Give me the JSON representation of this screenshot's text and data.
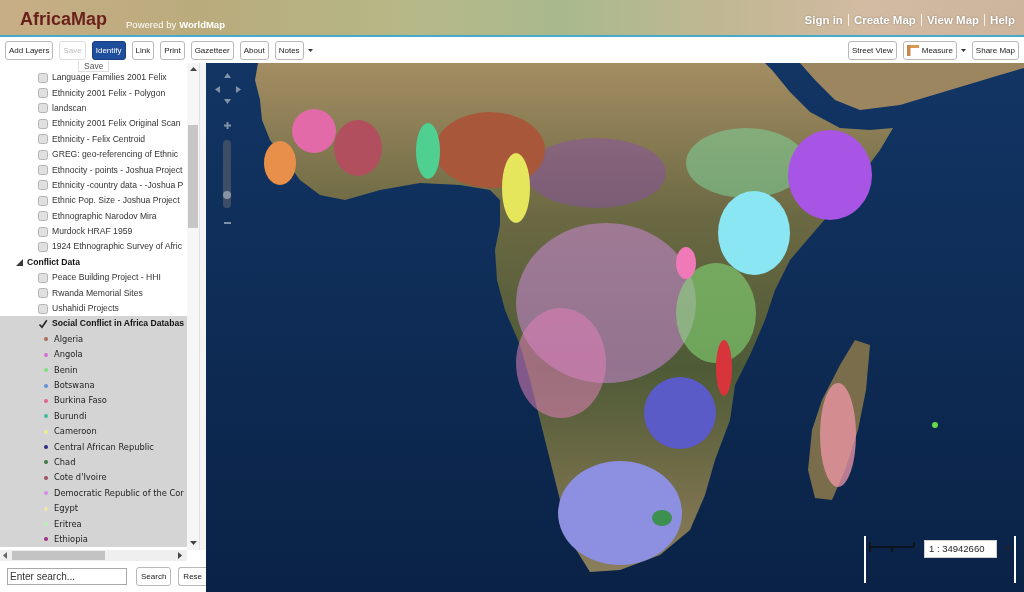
{
  "header": {
    "logo": "AfricaMap",
    "powered_by": {
      "text": "Powered by",
      "link": "WorldMap"
    },
    "links": [
      "Sign in",
      "Create Map",
      "View Map",
      "Help"
    ]
  },
  "toolbar": {
    "left": [
      {
        "label": "Add Layers",
        "disabled": false,
        "selected": false,
        "menu": false
      },
      {
        "label": "Save",
        "disabled": true,
        "selected": false,
        "menu": false
      },
      {
        "label": "Identify",
        "disabled": false,
        "selected": true,
        "menu": false
      },
      {
        "label": "Link",
        "disabled": false,
        "selected": false,
        "menu": false
      },
      {
        "label": "Print",
        "disabled": false,
        "selected": false,
        "menu": false
      },
      {
        "label": "Gazetteer",
        "disabled": false,
        "selected": false,
        "menu": false
      },
      {
        "label": "About",
        "disabled": false,
        "selected": false,
        "menu": false
      },
      {
        "label": "Notes",
        "disabled": false,
        "selected": false,
        "menu": true
      }
    ],
    "right": [
      {
        "label": "Street View",
        "kind": "plain",
        "menu": false
      },
      {
        "label": "Measure",
        "kind": "icon",
        "menu": true
      },
      {
        "label": "Share Map",
        "kind": "plain",
        "menu": false
      }
    ],
    "tooltip": "Save"
  },
  "layer_tree": [
    {
      "kind": "group",
      "children": [
        {
          "kind": "layer",
          "label": "Language Families 2001 Felix",
          "checked": false,
          "selected": false
        },
        {
          "kind": "layer",
          "label": "Ethnicity 2001 Felix - Polygon",
          "checked": false,
          "selected": false
        },
        {
          "kind": "layer",
          "label": "landscan",
          "checked": false,
          "selected": false
        },
        {
          "kind": "layer",
          "label": "Ethnicity 2001 Felix Original Scan",
          "checked": false,
          "selected": false
        },
        {
          "kind": "layer",
          "label": "Ethnicity - Felix Centroid",
          "checked": false,
          "selected": false
        },
        {
          "kind": "layer",
          "label": "GREG: geo-referencing of Ethnic",
          "checked": false,
          "selected": false
        },
        {
          "kind": "layer",
          "label": "Ethnocity - points - Joshua Project",
          "checked": false,
          "selected": false
        },
        {
          "kind": "layer",
          "label": "Ethnicity -country data - -Joshua P",
          "checked": false,
          "selected": false
        },
        {
          "kind": "layer",
          "label": "Ethnic Pop. Size - Joshua Project",
          "checked": false,
          "selected": false
        },
        {
          "kind": "layer",
          "label": "Ethnographic Narodov Mira",
          "checked": false,
          "selected": false
        },
        {
          "kind": "layer",
          "label": "Murdock HRAF 1959",
          "checked": false,
          "selected": false
        },
        {
          "kind": "layer",
          "label": "1924 Ethnographic Survey of Afric",
          "checked": false,
          "selected": false
        }
      ]
    },
    {
      "kind": "group",
      "label": "Conflict Data",
      "expanded": true,
      "selected": false,
      "children": [
        {
          "kind": "layer",
          "label": "Peace Building Project - HHI",
          "checked": false,
          "selected": false
        },
        {
          "kind": "layer",
          "label": "Rwanda Memorial Sites",
          "checked": false,
          "selected": false
        },
        {
          "kind": "layer",
          "label": "Ushahidi Projects",
          "checked": false,
          "selected": false
        },
        {
          "kind": "layer",
          "label": "Social Conflict in Africa Databas",
          "checked": true,
          "selected": true,
          "legend": [
            {
              "label": "Algeria",
              "color": "#a5705a"
            },
            {
              "label": "Angola",
              "color": "#d36fd6"
            },
            {
              "label": "Benin",
              "color": "#7fe07f"
            },
            {
              "label": "Botswana",
              "color": "#5f8fd6"
            },
            {
              "label": "Burkina Faso",
              "color": "#e0648a"
            },
            {
              "label": "Burundi",
              "color": "#3fb8a0"
            },
            {
              "label": "Cameroon",
              "color": "#eeee8a"
            },
            {
              "label": "Central African Republic",
              "color": "#2e2e7e"
            },
            {
              "label": "Chad",
              "color": "#3d7a3d"
            },
            {
              "label": "Cote d'Ivoire",
              "color": "#a0505e"
            },
            {
              "label": "Democratic Republic of the Cor",
              "color": "#cf90e6"
            },
            {
              "label": "Egypt",
              "color": "#f0e6a8"
            },
            {
              "label": "Eritrea",
              "color": "#b7f0b7"
            },
            {
              "label": "Ethiopia",
              "color": "#a02c84"
            }
          ]
        }
      ]
    }
  ],
  "search": {
    "placeholder": "Enter search...",
    "buttons": [
      "Search",
      "Rese"
    ]
  },
  "map": {
    "zoom_slider": {
      "level": 0.15
    },
    "scale": "1 : 34942660"
  }
}
